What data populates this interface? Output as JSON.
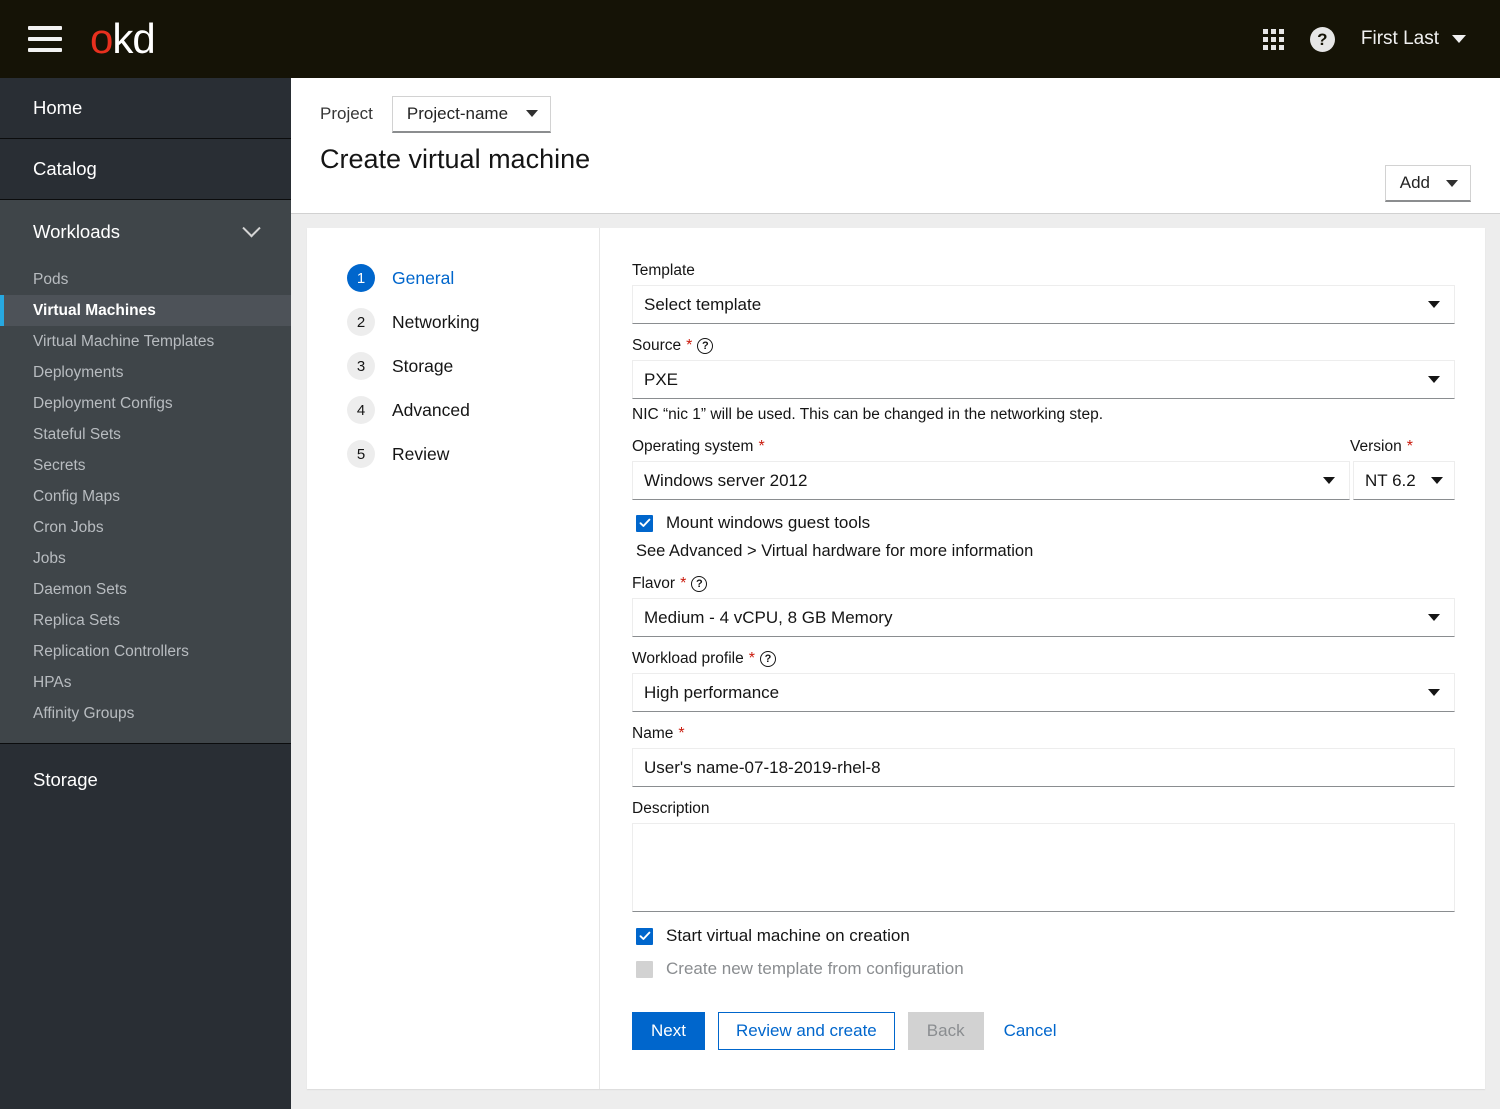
{
  "masthead": {
    "brand_o": "o",
    "brand_kd": "kd",
    "menu_icon": "hamburger-icon",
    "apps_icon": "grid-apps-icon",
    "help_icon": "?",
    "user_name": "First Last"
  },
  "sidebar": {
    "top_items": [
      {
        "label": "Home"
      },
      {
        "label": "Catalog"
      }
    ],
    "group": {
      "label": "Workloads",
      "items": [
        {
          "label": "Pods",
          "active": false
        },
        {
          "label": "Virtual Machines",
          "active": true
        },
        {
          "label": "Virtual Machine Templates",
          "active": false
        },
        {
          "label": "Deployments",
          "active": false
        },
        {
          "label": "Deployment Configs",
          "active": false
        },
        {
          "label": "Stateful Sets",
          "active": false
        },
        {
          "label": "Secrets",
          "active": false
        },
        {
          "label": "Config Maps",
          "active": false
        },
        {
          "label": "Cron Jobs",
          "active": false
        },
        {
          "label": "Jobs",
          "active": false
        },
        {
          "label": "Daemon Sets",
          "active": false
        },
        {
          "label": "Replica Sets",
          "active": false
        },
        {
          "label": "Replication Controllers",
          "active": false
        },
        {
          "label": "HPAs",
          "active": false
        },
        {
          "label": "Affinity Groups",
          "active": false
        }
      ]
    },
    "bottom_items": [
      {
        "label": "Storage"
      }
    ]
  },
  "page": {
    "project_label": "Project",
    "project_value": "Project-name",
    "add_button": "Add",
    "title": "Create virtual machine"
  },
  "wizard": {
    "steps": [
      {
        "num": "1",
        "label": "General"
      },
      {
        "num": "2",
        "label": "Networking"
      },
      {
        "num": "3",
        "label": "Storage"
      },
      {
        "num": "4",
        "label": "Advanced"
      },
      {
        "num": "5",
        "label": "Review"
      }
    ],
    "form": {
      "template_label": "Template",
      "template_value": "Select template",
      "source_label": "Source",
      "source_value": "PXE",
      "source_helper": "NIC “nic 1” will be used. This can be changed in the networking step.",
      "os_label": "Operating system",
      "os_value": "Windows server 2012",
      "version_label": "Version",
      "version_value": "NT 6.2",
      "mount_tools_label": "Mount windows guest tools",
      "advanced_note": "See Advanced  > Virtual hardware for more information",
      "flavor_label": "Flavor",
      "flavor_value": "Medium - 4 vCPU, 8 GB Memory",
      "workload_label": "Workload profile",
      "workload_value": "High performance",
      "name_label": "Name",
      "name_value": "User's name-07-18-2019-rhel-8",
      "description_label": "Description",
      "description_value": "",
      "start_vm_label": "Start virtual machine on creation",
      "create_template_label": "Create new template from configuration"
    },
    "actions": {
      "next": "Next",
      "review_and_create": "Review and create",
      "back": "Back",
      "cancel": "Cancel"
    }
  },
  "colors": {
    "accent_blue": "#0066cc",
    "brand_red": "#e8301e",
    "masthead_bg": "#151306",
    "sidebar_bg": "#292e34",
    "sidebar_group_bg": "#3f4549",
    "active_item_bg": "#4d5258",
    "active_marker": "#27a8e0",
    "required_red": "#c9190b",
    "page_bg": "#ededed"
  }
}
